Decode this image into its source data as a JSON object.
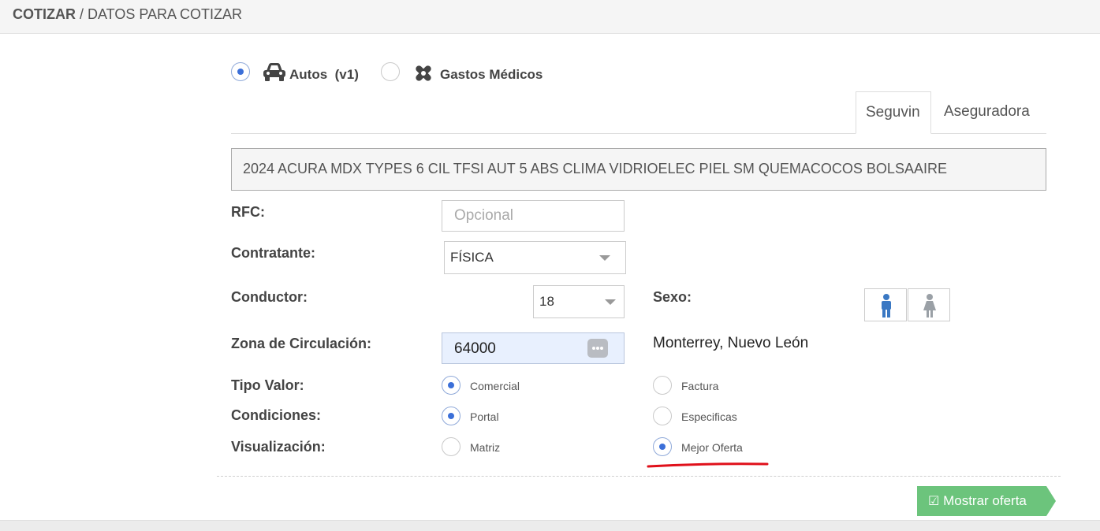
{
  "breadcrumb": {
    "section": "COTIZAR",
    "separator": " / ",
    "page": "DATOS PARA COTIZAR"
  },
  "product": {
    "autos_label": "Autos",
    "autos_version": "(v1)",
    "gastos_label": "Gastos Médicos",
    "selected": "autos"
  },
  "tabs": [
    {
      "label": "Seguvin",
      "active": true
    },
    {
      "label": "Aseguradora",
      "active": false
    }
  ],
  "vehicle_description": "2024 ACURA MDX TYPES 6 CIL TFSI AUT 5 ABS CLIMA VIDRIOELEC PIEL SM QUEMACOCOS BOLSAAIRE",
  "form": {
    "rfc_label": "RFC:",
    "rfc_placeholder": "Opcional",
    "contratante_label": "Contratante:",
    "contratante_value": "FÍSICA",
    "conductor_label": "Conductor:",
    "conductor_value": "18",
    "sexo_label": "Sexo:",
    "sexo_selected": "masculino",
    "zona_label": "Zona de Circulación:",
    "zona_value": "64000",
    "zona_city": "Monterrey, Nuevo León",
    "tipo_valor_label": "Tipo Valor:",
    "tipo_valor_options": [
      "Comercial",
      "Factura"
    ],
    "tipo_valor_selected": "Comercial",
    "condiciones_label": "Condiciones:",
    "condiciones_options": [
      "Portal",
      "Especificas"
    ],
    "condiciones_selected": "Portal",
    "visualizacion_label": "Visualización:",
    "visualizacion_options": [
      "Matriz",
      "Mejor Oferta"
    ],
    "visualizacion_selected": "Mejor Oferta"
  },
  "submit_label": "Mostrar oferta",
  "colors": {
    "accent": "#3b6fd8",
    "submit": "#6cc47c",
    "male": "#3a78c3",
    "female": "#9aa0a6",
    "annotation": "#e0101a"
  }
}
